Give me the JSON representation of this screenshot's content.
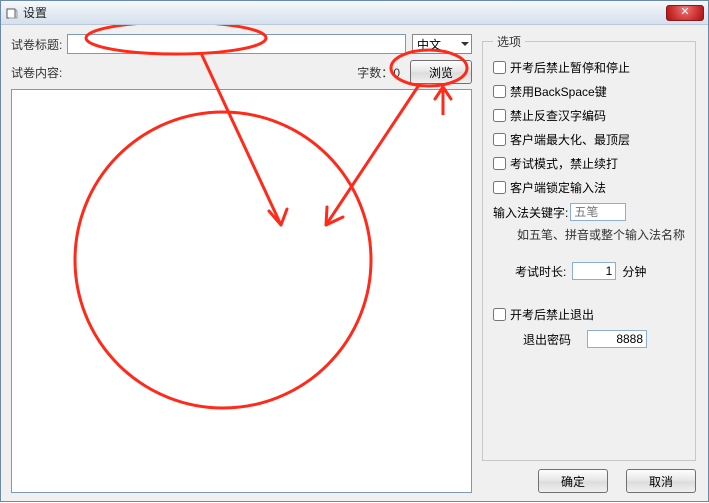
{
  "window": {
    "title": "设置",
    "close_glyph": "✕"
  },
  "left": {
    "title_label": "试卷标题:",
    "title_value": "",
    "lang_selected": "中文",
    "content_label": "试卷内容:",
    "charcount_label": "字数：",
    "charcount_value": "0",
    "browse_label": "浏览",
    "content_value": ""
  },
  "options": {
    "legend": "选项",
    "checks": [
      "开考后禁止暂停和停止",
      "禁用BackSpace键",
      "禁止反查汉字编码",
      "客户端最大化、最顶层",
      "考试模式，禁止续打",
      "客户端锁定输入法"
    ],
    "ime_label": "输入法关键字:",
    "ime_placeholder": "五笔",
    "ime_hint": "如五笔、拼音或整个输入法名称",
    "duration_label": "考试时长:",
    "duration_value": "1",
    "duration_unit": "分钟",
    "forbid_exit_label": "开考后禁止退出",
    "exit_pwd_label": "退出密码",
    "exit_pwd_value": "8888"
  },
  "footer": {
    "ok": "确定",
    "cancel": "取消"
  }
}
